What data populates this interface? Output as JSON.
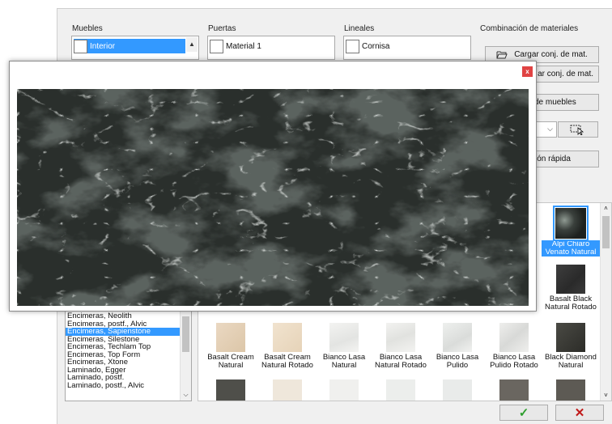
{
  "groups": {
    "muebles": {
      "label": "Muebles",
      "selected": "Interior"
    },
    "puertas": {
      "label": "Puertas",
      "selected": "Material 1"
    },
    "lineales": {
      "label": "Lineales",
      "selected": "Cornisa"
    },
    "combinacion": {
      "label": "Combinación de materiales"
    }
  },
  "buttons": {
    "cargar": "Cargar conj. de mat.",
    "guardar": "ar conj. de mat.",
    "muebles": "de muebles",
    "rapida": "ción rápida"
  },
  "categories": [
    "Encimeras, Neolith",
    "Encimeras, postf., Alvic",
    "Encimeras, Sapienstone",
    "Encimeras, Silestone",
    "Encimeras, Techlam Top",
    "Encimeras, Top Form",
    "Encimeras, Xtone",
    "Laminado, Egger",
    "Laminado, postf.",
    "Laminado, postf., Alvic"
  ],
  "selected_category_index": 2,
  "materials": {
    "top_partial_label": "o",
    "alpi": "Alpi Chiaro Venato Natural",
    "basalt_black": "Basalt Black Natural Rotado",
    "row": [
      "Basalt Cream Natural",
      "Basalt Cream Natural Rotado",
      "Bianco Lasa Natural",
      "Bianco Lasa Natural Rotado",
      "Bianco Lasa Pulido",
      "Bianco Lasa Pulido Rotado",
      "Black Diamond Natural"
    ]
  },
  "actions": {
    "ok": "✓",
    "cancel": "✕"
  },
  "preview": {
    "close": "x"
  },
  "colors": {
    "selection": "#3399ff",
    "ok": "#2e9e2e",
    "cancel": "#c01818",
    "close": "#e04343"
  }
}
